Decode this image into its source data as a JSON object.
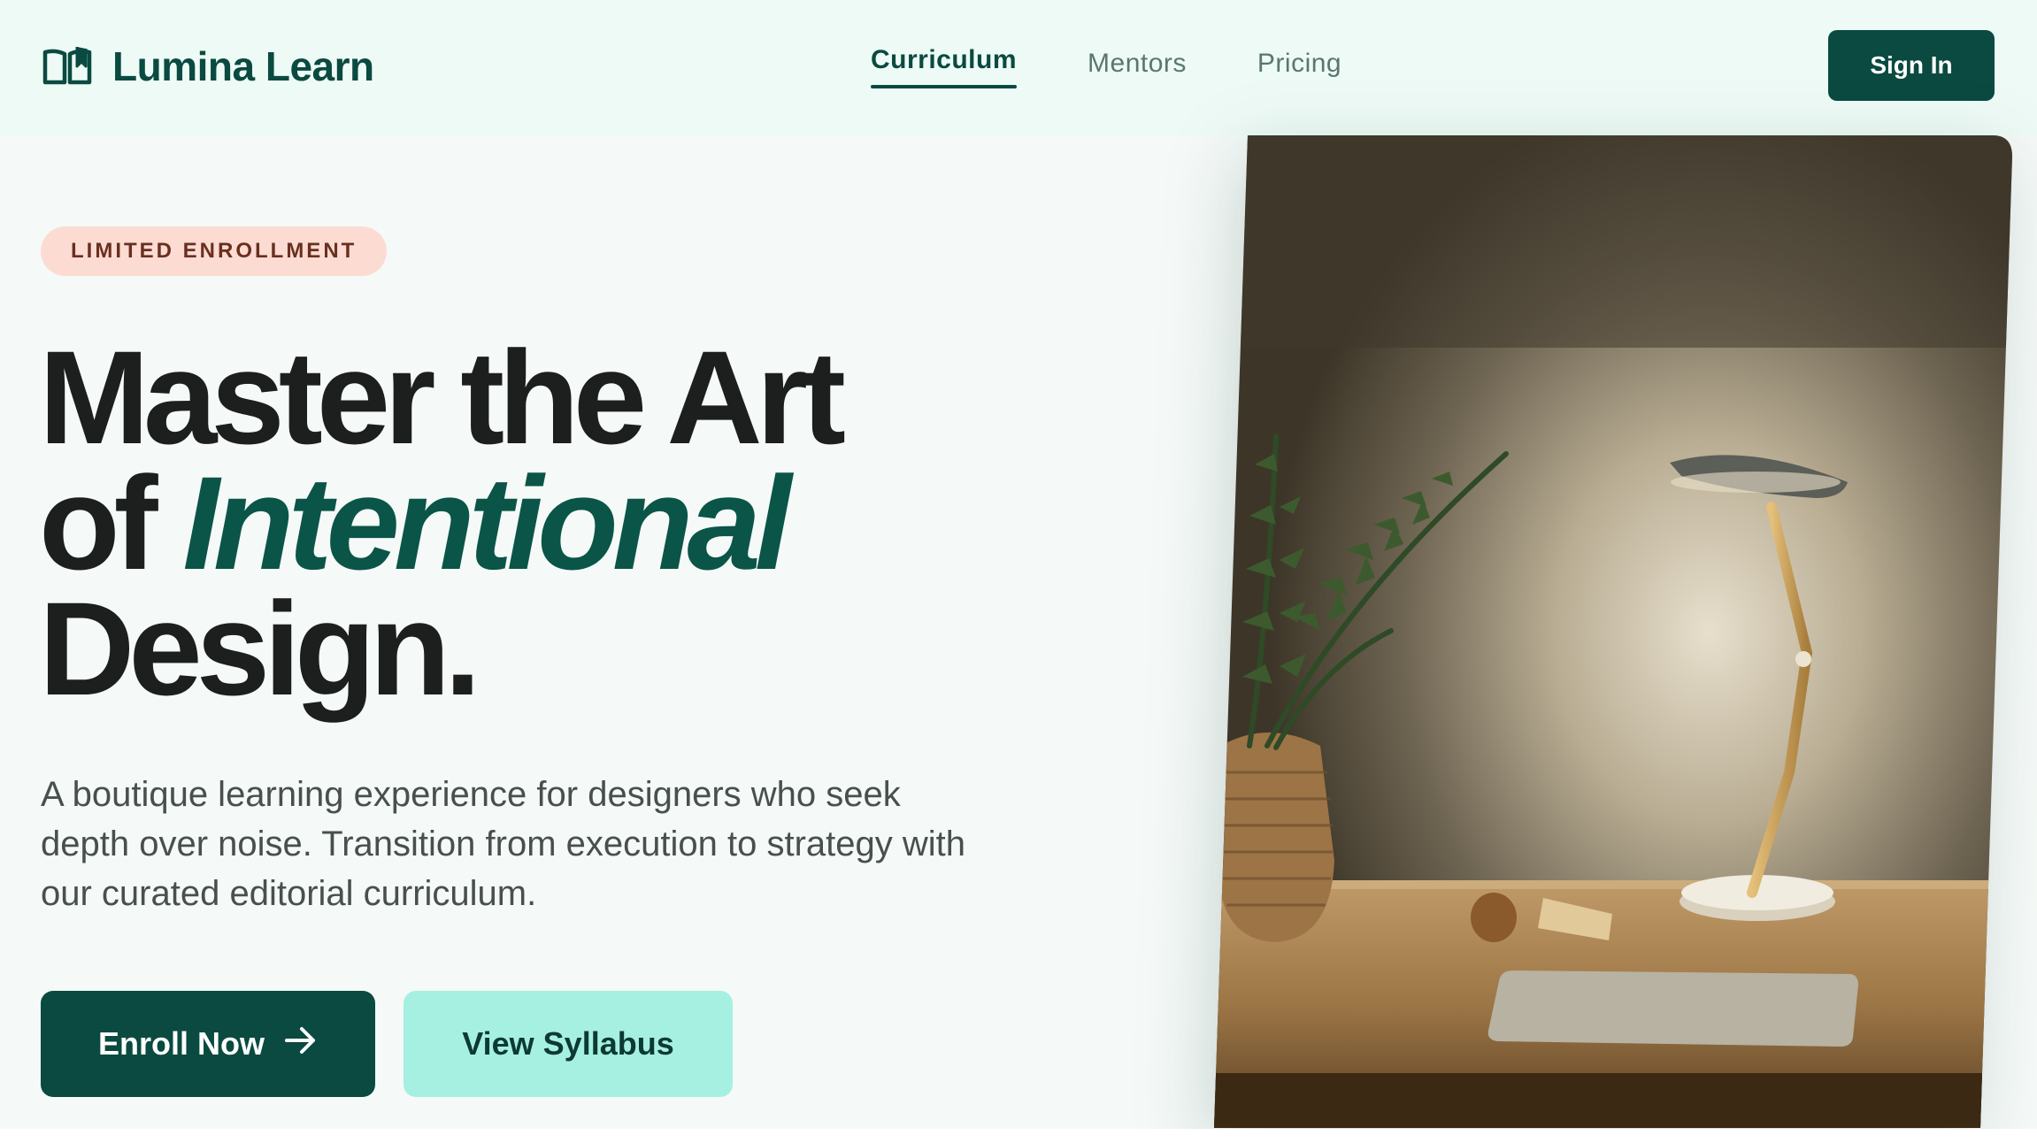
{
  "header": {
    "brand_name": "Lumina Learn",
    "brand_icon": "open-book-icon",
    "nav": [
      {
        "label": "Curriculum",
        "active": true
      },
      {
        "label": "Mentors",
        "active": false
      },
      {
        "label": "Pricing",
        "active": false
      }
    ],
    "sign_in_label": "Sign In"
  },
  "hero": {
    "badge": "LIMITED ENROLLMENT",
    "headline_line1": "Master the Art",
    "headline_line2_prefix": "of ",
    "headline_line2_accent": "Intentional",
    "headline_line3": "Design.",
    "lede": "A boutique learning experience for designers who seek depth over noise. Transition from execution to strategy with our curated editorial curriculum.",
    "primary_cta": "Enroll Now",
    "primary_cta_icon": "arrow-right-icon",
    "secondary_cta": "View Syllabus",
    "image_subject": "desk-lamp-with-plant-photo"
  },
  "colors": {
    "brand": "#0a4a40",
    "accent_text": "#0a5548",
    "badge_bg": "#fcdcd2",
    "badge_text": "#6a2f20",
    "secondary_bg": "#a6f0e1",
    "header_bg": "#eefaf5",
    "page_bg": "#f5f9f7"
  }
}
